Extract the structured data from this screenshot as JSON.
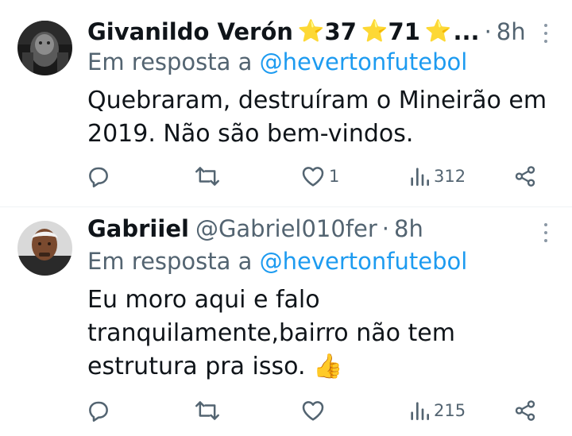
{
  "tweets": [
    {
      "name": "Givanildo Verón",
      "badges": [
        "37",
        "71"
      ],
      "badge_overflow": "...",
      "handle": "",
      "time": "8h",
      "reply_prefix": "Em resposta a",
      "reply_to": "@hevertonfutebol",
      "text_lines": [
        "Quebraram, destruíram o Mineirão em",
        "2019. Não são bem-vindos."
      ],
      "likes": "1",
      "views": "312"
    },
    {
      "name": "Gabriiel",
      "handle": "@Gabriel010fer",
      "time": "8h",
      "reply_prefix": "Em resposta a",
      "reply_to": "@hevertonfutebol",
      "text_lines": [
        "Eu moro aqui e falo",
        "tranquilamente,bairro não tem",
        "estrutura pra isso."
      ],
      "emoji": "👍",
      "likes": "",
      "views": "215"
    }
  ],
  "colors": {
    "text": "#0f1419",
    "secondary": "#536471",
    "link": "#1d9bf0",
    "star": "#f5b90a"
  },
  "icons": [
    "reply-icon",
    "retweet-icon",
    "like-icon",
    "views-icon",
    "share-icon",
    "more-icon",
    "star-icon"
  ]
}
